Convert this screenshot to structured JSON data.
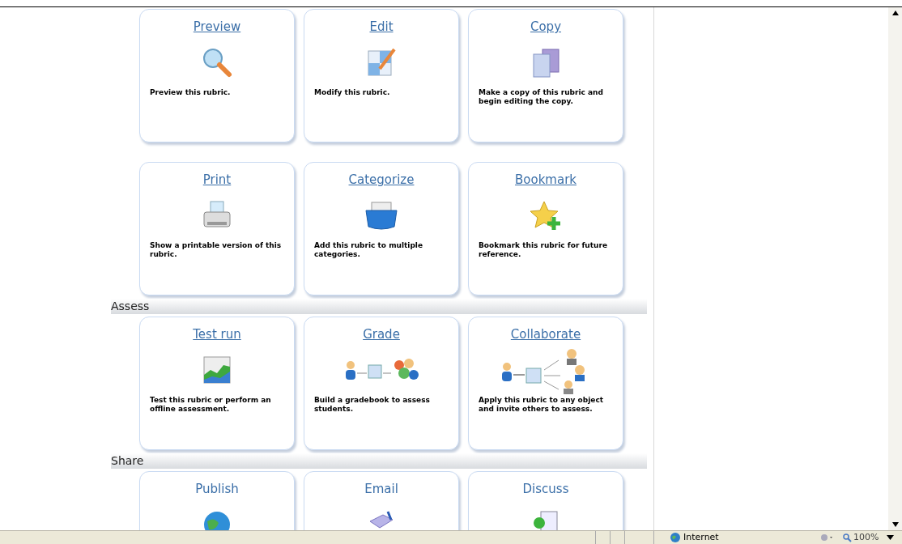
{
  "sections": [
    {
      "cards": [
        {
          "title": "Preview",
          "underlined": true,
          "description": "Preview this rubric."
        },
        {
          "title": "Edit",
          "underlined": true,
          "description": "Modify this rubric."
        },
        {
          "title": "Copy",
          "underlined": true,
          "description": "Make a copy of this rubric and begin editing the copy."
        },
        {
          "title": "Print",
          "underlined": true,
          "description": "Show a printable version of this rubric."
        },
        {
          "title": "Categorize",
          "underlined": true,
          "description": "Add this rubric to multiple categories."
        },
        {
          "title": "Bookmark",
          "underlined": true,
          "description": "Bookmark this rubric for future reference."
        }
      ]
    },
    {
      "title": "Assess",
      "cards": [
        {
          "title": "Test run",
          "underlined": true,
          "description": "Test this rubric or perform an offline assessment."
        },
        {
          "title": "Grade",
          "underlined": true,
          "description": "Build a gradebook to assess students."
        },
        {
          "title": "Collaborate",
          "underlined": true,
          "description": "Apply this rubric to any object and invite others to assess."
        }
      ]
    },
    {
      "title": "Share",
      "cards": [
        {
          "title": "Publish",
          "underlined": false
        },
        {
          "title": "Email",
          "underlined": false
        },
        {
          "title": "Discuss",
          "underlined": false
        }
      ]
    }
  ],
  "status_bar": {
    "zone": "Internet",
    "zoom": "100%"
  }
}
